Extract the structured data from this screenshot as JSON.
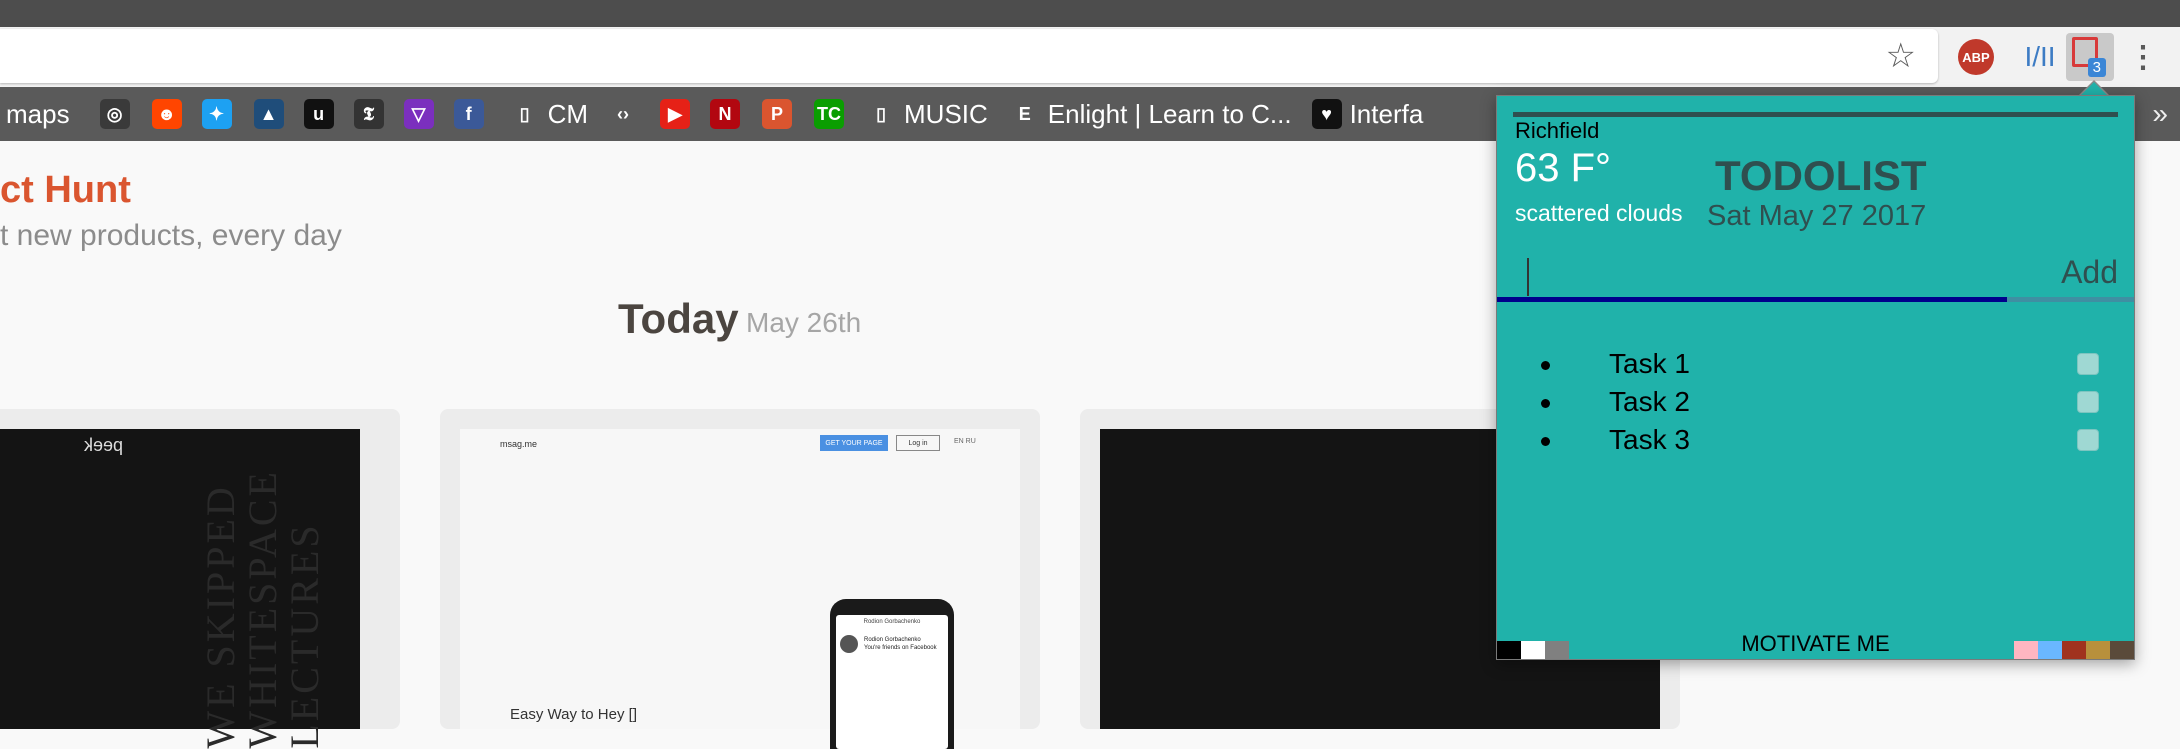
{
  "browser": {
    "bookmark_star": "☆",
    "extensions": {
      "abp_label": "ABP",
      "ilil_label": "I/II",
      "todo_badge": "3",
      "menu_glyph": "⋮"
    },
    "bookmarks": [
      {
        "label": "maps",
        "icon": "maps-icon",
        "icon_glyph": "",
        "color": "transparent"
      },
      {
        "label": "",
        "icon": "spy-icon",
        "icon_glyph": "◎",
        "color": "#3a3a3a"
      },
      {
        "label": "",
        "icon": "reddit-icon",
        "icon_glyph": "☻",
        "color": "#ff4500"
      },
      {
        "label": "",
        "icon": "twitter-icon",
        "icon_glyph": "✦",
        "color": "#1da1f2"
      },
      {
        "label": "",
        "icon": "sailboat-icon",
        "icon_glyph": "▲",
        "color": "#1f4d7a"
      },
      {
        "label": "",
        "icon": "upwork-icon",
        "icon_glyph": "u",
        "color": "#111111"
      },
      {
        "label": "",
        "icon": "nytimes-icon",
        "icon_glyph": "𝕿",
        "color": "#333333"
      },
      {
        "label": "",
        "icon": "vivaldi-icon",
        "icon_glyph": "▽",
        "color": "#7b2fbe"
      },
      {
        "label": "",
        "icon": "facebook-icon",
        "icon_glyph": "f",
        "color": "#3b5998"
      },
      {
        "label": "CM",
        "icon": "page-icon",
        "icon_glyph": "▯",
        "color": "transparent"
      },
      {
        "label": "",
        "icon": "code-icon",
        "icon_glyph": "‹›",
        "color": "transparent"
      },
      {
        "label": "",
        "icon": "youtube-icon",
        "icon_glyph": "▶",
        "color": "#e62117"
      },
      {
        "label": "",
        "icon": "netflix-icon",
        "icon_glyph": "N",
        "color": "#b20710"
      },
      {
        "label": "",
        "icon": "producthunt-icon",
        "icon_glyph": "P",
        "color": "#da552f"
      },
      {
        "label": "",
        "icon": "techcrunch-icon",
        "icon_glyph": "TC",
        "color": "#0a9e01"
      },
      {
        "label": "MUSIC",
        "icon": "page-icon",
        "icon_glyph": "▯",
        "color": "transparent"
      },
      {
        "label": "Enlight | Learn to C...",
        "icon": "enlight-icon",
        "icon_glyph": "E",
        "color": "transparent"
      },
      {
        "label": "Interfa",
        "icon": "heart-icon",
        "icon_glyph": "♥",
        "color": "#111111"
      }
    ],
    "bookmarks_more": "»"
  },
  "page": {
    "brand_title": "ct Hunt",
    "brand_subtitle": "t new products, every day",
    "today_label": "Today",
    "today_date": "May 26th",
    "card1": {
      "peek_label": "peek",
      "ghost_text": "WE SKIPPED WHITESPACE LECTURES"
    },
    "card2": {
      "logo": "msag.me",
      "get_page": "GET YOUR PAGE",
      "login": "Log in",
      "lang": "EN  RU",
      "tagline": "Easy Way to Hey []",
      "phone_head": "Rodion Gorbachenko",
      "phone_name": "Rodion Gorbachenko",
      "phone_line": "You're friends on Facebook"
    }
  },
  "popup": {
    "weather": {
      "city": "Richfield",
      "temperature": "63 F°",
      "condition": "scattered clouds"
    },
    "title": "TODOLIST",
    "date": "Sat May 27 2017",
    "input_value": "",
    "add_label": "Add",
    "tasks": [
      {
        "text": "Task 1",
        "done": false
      },
      {
        "text": "Task 2",
        "done": false
      },
      {
        "text": "Task 3",
        "done": false
      }
    ],
    "motivate_label": "MOTIVATE ME",
    "colors": {
      "background": "#20b2aa",
      "accent_dark": "#2f4f4f",
      "underline": "#00008b"
    },
    "swatches_left": [
      "#000000",
      "#ffffff",
      "#808080"
    ],
    "swatches_right": [
      "#ffb6c1",
      "#6ab7ff",
      "#a0321e",
      "#b8903c",
      "#5a4a3a"
    ]
  }
}
